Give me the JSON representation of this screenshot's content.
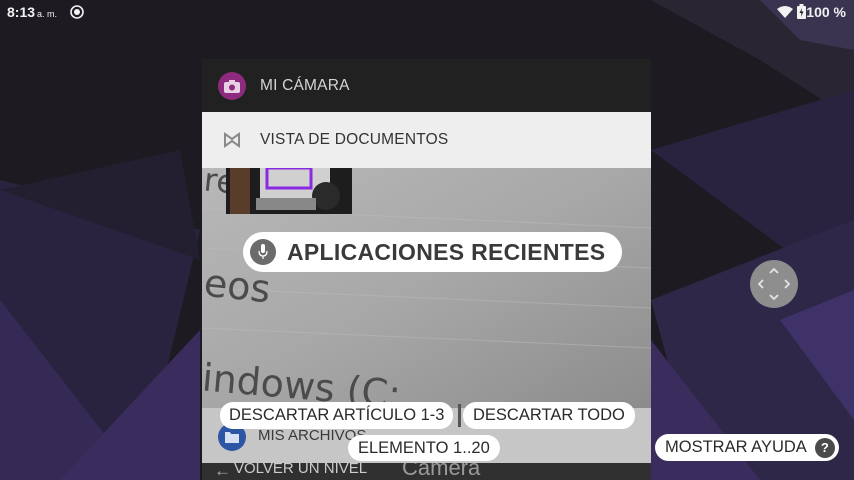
{
  "status_bar": {
    "time": "8:13",
    "ampm": "a. m.",
    "battery": "100 %",
    "icons": [
      "sync-icon",
      "wifi-icon",
      "battery-icon"
    ]
  },
  "recents": {
    "camera_card": {
      "title": "MI CÁMARA",
      "icon": "camera-icon",
      "icon_color": "#8e2b7e"
    },
    "docs_card": {
      "title": "VISTA DE DOCUMENTOS",
      "icon": "documents-icon"
    },
    "files_card": {
      "title": "MIS ARCHIVOS",
      "icon": "folder-icon",
      "icon_color": "#2c55a4"
    },
    "bottom_card": {
      "back_label": "VOLVER UN NIVEL",
      "title": "Camera"
    }
  },
  "voice_overlay": {
    "title": "APLICACIONES RECIENTES",
    "dismiss_item": "DESCARTAR ARTÍCULO 1-3",
    "dismiss_all": "DESCARTAR TODO",
    "element_range": "ELEMENTO 1..20",
    "show_help": "MOSTRAR AYUDA",
    "help_glyph": "?"
  },
  "preview_text": [
    "re",
    "eos",
    "indows (C:"
  ]
}
